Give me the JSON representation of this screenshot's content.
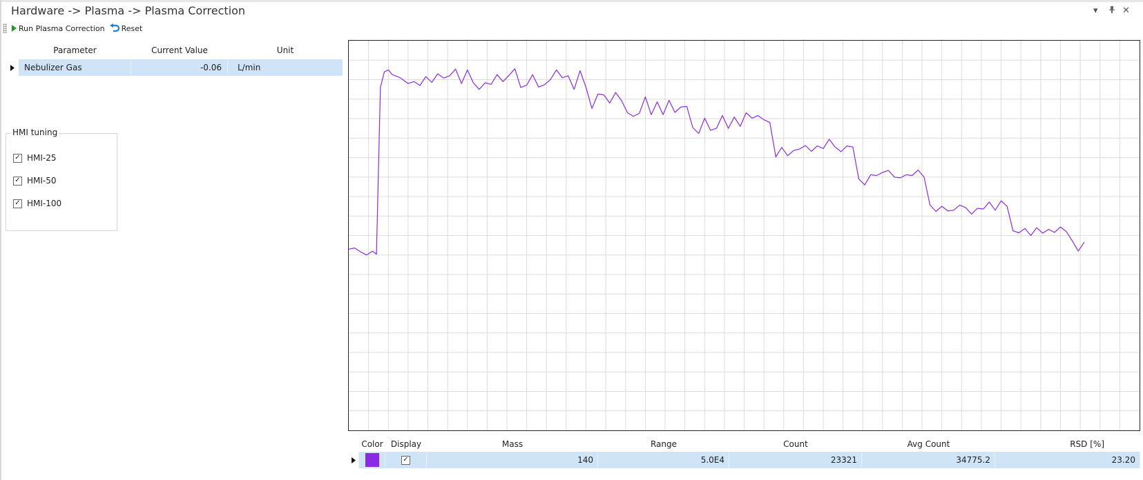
{
  "window": {
    "title": "Hardware -> Plasma -> Plasma Correction",
    "controls": [
      "dropdown",
      "pin",
      "close"
    ]
  },
  "toolbar": {
    "run_label": "Run Plasma Correction",
    "reset_label": "Reset"
  },
  "parameter_grid": {
    "headers": [
      "Parameter",
      "Current Value",
      "Unit"
    ],
    "rows": [
      {
        "parameter": "Nebulizer Gas",
        "current_value": "-0.06",
        "unit": "L/min"
      }
    ]
  },
  "hmi_tuning": {
    "title": "HMI tuning",
    "options": [
      {
        "label": "HMI-25",
        "checked": true
      },
      {
        "label": "HMI-50",
        "checked": true
      },
      {
        "label": "HMI-100",
        "checked": true
      }
    ]
  },
  "chart_data": {
    "type": "line",
    "title": "",
    "xlabel": "",
    "ylabel": "",
    "grid": true,
    "xlim": [
      0,
      40
    ],
    "ylim": [
      0,
      100
    ],
    "series": [
      {
        "color": "#8a2be2",
        "x": [
          0,
          0.3,
          0.6,
          0.9,
          1.2,
          1.4,
          1.6,
          1.8,
          2.0,
          2.2,
          2.6,
          3.0,
          3.3,
          3.6,
          3.9,
          4.2,
          4.5,
          4.8,
          5.1,
          5.4,
          5.7,
          6.0,
          6.3,
          6.6,
          6.9,
          7.2,
          7.5,
          7.8,
          8.1,
          8.4,
          8.7,
          9.0,
          9.3,
          9.6,
          9.9,
          10.2,
          10.5,
          10.8,
          11.1,
          11.4,
          11.7,
          12.0,
          12.3,
          12.6,
          12.9,
          13.2,
          13.5,
          13.8,
          14.1,
          14.4,
          14.7,
          15.0,
          15.3,
          15.6,
          15.9,
          16.2,
          16.5,
          16.8,
          17.1,
          17.4,
          17.7,
          18.0,
          18.3,
          18.6,
          18.9,
          19.2,
          19.5,
          19.8,
          20.1,
          20.4,
          20.7,
          21.0,
          21.3,
          21.6,
          21.9,
          22.2,
          22.5,
          22.8,
          23.1,
          23.4,
          23.7,
          24.0,
          24.3,
          24.6,
          24.9,
          25.2,
          25.5,
          25.8,
          26.1,
          26.4,
          26.7,
          27.0,
          27.3,
          27.6,
          27.9,
          28.2,
          28.5,
          28.8,
          29.1,
          29.4,
          29.7,
          30.0,
          30.3,
          30.6,
          30.9,
          31.2,
          31.5,
          31.8,
          32.1,
          32.4,
          32.7,
          33.0,
          33.3,
          33.6,
          33.9,
          34.2,
          34.5,
          34.8,
          35.1,
          35.4,
          35.7,
          36.0,
          36.3,
          36.6,
          36.9,
          37.2
        ],
        "y": [
          46.5,
          46.8,
          45.8,
          45.0,
          46.0,
          45.2,
          88,
          92,
          92.5,
          91.3,
          90.5,
          89.0,
          89.5,
          88.5,
          90.8,
          89.3,
          91.5,
          90.4,
          91.0,
          92.7,
          89.0,
          92.5,
          89.2,
          87.5,
          89.2,
          88.8,
          91.3,
          89.5,
          91.1,
          92.8,
          88.0,
          88.6,
          91.3,
          88.1,
          88.7,
          90.0,
          92.5,
          90.5,
          91.0,
          87.5,
          92.3,
          88.0,
          82.6,
          86.3,
          86.1,
          84.0,
          86.7,
          84.6,
          81.5,
          80.6,
          81.4,
          85.6,
          81.0,
          84.3,
          81.0,
          84.7,
          81.6,
          83.0,
          83.1,
          77.7,
          76.2,
          80.1,
          77.0,
          77.5,
          80.8,
          77.5,
          80.4,
          78.0,
          81.5,
          80.1,
          80.8,
          79.7,
          79.0,
          70.2,
          72.6,
          70.5,
          71.8,
          72.2,
          73.1,
          71.6,
          73.0,
          72.3,
          74.7,
          72.7,
          71.5,
          73.0,
          72.7,
          64.5,
          63.0,
          65.6,
          65.4,
          66.2,
          66.7,
          65.0,
          64.8,
          65.6,
          65.4,
          66.8,
          65.0,
          57.8,
          56.2,
          57.5,
          56.3,
          56.5,
          57.8,
          57.2,
          55.5,
          57.0,
          56.8,
          58.6,
          56.5,
          58.9,
          57.5,
          51.2,
          50.7,
          51.8,
          50.0,
          52.0,
          50.6,
          51.6,
          50.8,
          52.2,
          51.0,
          48.6,
          46.0,
          48.3
        ]
      }
    ]
  },
  "results_grid": {
    "headers": [
      "Color",
      "Display",
      "Mass",
      "Range",
      "Count",
      "Avg Count",
      "RSD [%]"
    ],
    "rows": [
      {
        "color": "#8a2be2",
        "display": true,
        "mass": "140",
        "range": "5.0E4",
        "count": "23321",
        "avg_count": "34775.2",
        "rsd": "23.20"
      }
    ]
  }
}
